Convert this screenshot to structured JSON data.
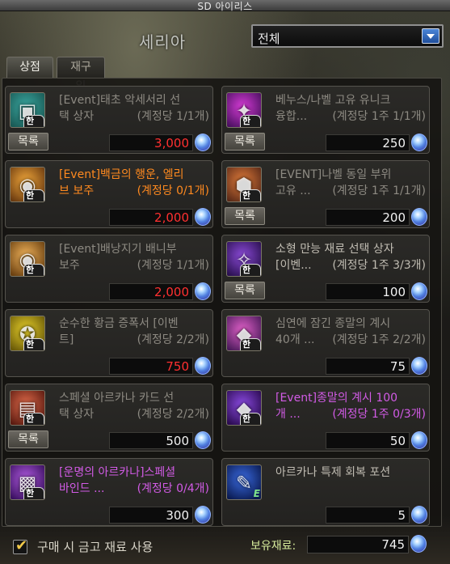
{
  "window": {
    "title": "SD 아이리스"
  },
  "header": {
    "npc_name": "세리아",
    "filter": {
      "selected": "전체"
    }
  },
  "tabs": [
    {
      "label": "상점",
      "active": true
    },
    {
      "label": "재구입",
      "active": false
    }
  ],
  "shop": {
    "limit_badge": "한정",
    "list_button_label": "목록",
    "items": [
      {
        "line1": "[Event]태초 악세서리 선",
        "line2": "택 상자",
        "limit": "(계정당 1/1개)",
        "price": "3,000",
        "price_red": true,
        "name_color": "gray",
        "has_list_button": true,
        "icon": "box-icon",
        "icon_colors": [
          "#3aa7a0",
          "#1a5a55"
        ]
      },
      {
        "line1": "베누스/나벨 고유 유니크",
        "line2": "융합...",
        "limit": "(계정당 1주 1/1개)",
        "price": "250",
        "price_red": false,
        "name_color": "gray",
        "has_list_button": true,
        "icon": "sword-icon",
        "icon_colors": [
          "#d63bd6",
          "#4a1060"
        ]
      },
      {
        "line1": "[Event]백금의 행운, 엘리",
        "line2": "브 보주",
        "limit": "(계정당 0/1개)",
        "price": "2,000",
        "price_red": true,
        "name_color": "orange",
        "has_list_button": false,
        "icon": "orb-icon",
        "icon_colors": [
          "#f0a63a",
          "#6a3a10"
        ]
      },
      {
        "line1": "[EVENT]나벨 동일 부위",
        "line2": "고유 ...",
        "limit": "(계정당 1주 1/1개)",
        "price": "200",
        "price_red": false,
        "name_color": "gray",
        "has_list_button": true,
        "icon": "armor-icon",
        "icon_colors": [
          "#e07b3a",
          "#5a2a18"
        ]
      },
      {
        "line1": "[Event]배낭지기 배니부",
        "line2": "보주",
        "limit": "(계정당 1/1개)",
        "price": "2,000",
        "price_red": true,
        "name_color": "gray",
        "has_list_button": false,
        "icon": "orb-icon",
        "icon_colors": [
          "#f0b25a",
          "#6a4010"
        ]
      },
      {
        "line1": "소형 만능 재료 선택 상자",
        "line2": "[이벤...",
        "limit": "(계정당 1주 3/3개)",
        "price": "100",
        "price_red": false,
        "name_color": "bright",
        "has_list_button": true,
        "icon": "material-icon",
        "icon_colors": [
          "#8a4ad6",
          "#2a1050"
        ]
      },
      {
        "line1": "순수한 황금 증폭서 [이벤",
        "line2": "트]",
        "limit": "(계정당 2/2개)",
        "price": "750",
        "price_red": true,
        "name_color": "gray",
        "has_list_button": false,
        "icon": "scroll-icon",
        "icon_colors": [
          "#e8d02a",
          "#6a5a08"
        ]
      },
      {
        "line1": "심연에 잠긴 종말의 계시",
        "line2": "40개 ...",
        "limit": "(계정당 1주 2/2개)",
        "price": "75",
        "price_red": false,
        "name_color": "gray",
        "has_list_button": false,
        "icon": "gem-icon",
        "icon_colors": [
          "#e060c8",
          "#4a1a5a"
        ]
      },
      {
        "line1": "스페셜 아르카나 카드 선",
        "line2": "택 상자",
        "limit": "(계정당 2/2개)",
        "price": "500",
        "price_red": false,
        "name_color": "gray",
        "has_list_button": true,
        "icon": "card-icon",
        "icon_colors": [
          "#e06a4a",
          "#5a1a10"
        ]
      },
      {
        "line1": "[Event]종말의 계시 100",
        "line2": "개 ...",
        "limit": "(계정당 1주 0/3개)",
        "price": "50",
        "price_red": false,
        "name_color": "purple",
        "has_list_button": false,
        "icon": "gem-icon",
        "icon_colors": [
          "#8a4ae0",
          "#2a0a50"
        ]
      },
      {
        "line1": "[운명의 아르카나]스페셜",
        "line2": "바인드 ...",
        "limit": "(계정당 0/4개)",
        "price": "300",
        "price_red": false,
        "name_color": "purple",
        "has_list_button": false,
        "icon": "chest-icon",
        "icon_colors": [
          "#b05ae0",
          "#3a1060"
        ]
      },
      {
        "line1": "아르카나 특제 회복 포션",
        "line2": "",
        "limit": "",
        "price": "5",
        "price_red": false,
        "name_color": "bright",
        "has_list_button": false,
        "icon": "potion-icon",
        "icon_colors": [
          "#3a6ae0",
          "#0a1a50"
        ],
        "badge": "E"
      }
    ]
  },
  "footer": {
    "use_material_checkbox": {
      "checked": true,
      "label": "구매 시 금고 재료 사용"
    },
    "balance_label": "보유재료:",
    "balance_value": "745"
  },
  "colors": {
    "price_red": "#ff3030",
    "name_orange": "#ff8a1f",
    "name_purple": "#d25be6",
    "accent_blue": "#3a6ad6"
  }
}
